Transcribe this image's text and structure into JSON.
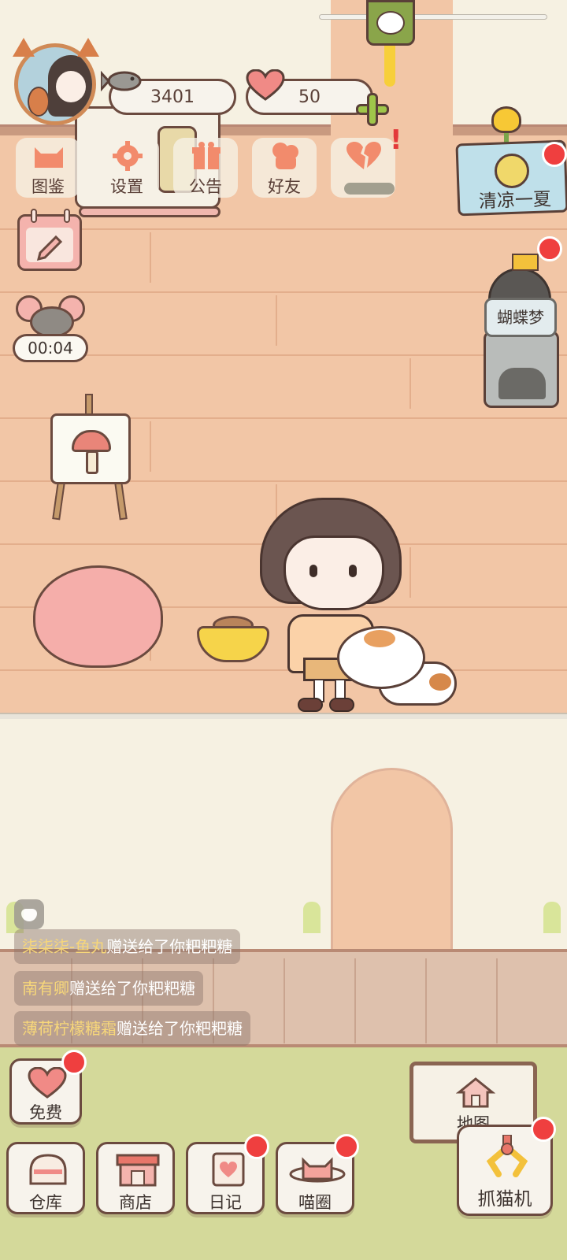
{
  "resources": {
    "fish_count": "3401",
    "heart_count": "50"
  },
  "top_menu": {
    "items": [
      {
        "label": "图鉴",
        "icon": "cat-head-icon"
      },
      {
        "label": "设置",
        "icon": "gear-icon"
      },
      {
        "label": "公告",
        "icon": "gift-icon"
      },
      {
        "label": "好友",
        "icon": "friends-icon"
      },
      {
        "label": "",
        "icon": "broken-heart-icon"
      }
    ]
  },
  "event": {
    "label": "清凉一夏"
  },
  "dream": {
    "label": "蝴蝶梦"
  },
  "timer": {
    "value": "00:04"
  },
  "chat": {
    "messages": [
      {
        "who": "柒柒柒-鱼丸",
        "text": "赠送给了你粑粑糖"
      },
      {
        "who": "南有卿",
        "text": "赠送给了你粑粑糖"
      },
      {
        "who": "薄荷柠檬糖霜",
        "text": "赠送给了你粑粑糖"
      }
    ]
  },
  "bottom": {
    "free": "免费",
    "warehouse": "仓库",
    "shop": "商店",
    "diary": "日记",
    "cat_circle": "喵圈",
    "map": "地图",
    "claw_machine": "抓猫机"
  },
  "colors": {
    "accent_red": "#ef3f3f",
    "wall": "#f2c6a6",
    "grass": "#d4d99a",
    "outline": "#6b4a3f"
  }
}
